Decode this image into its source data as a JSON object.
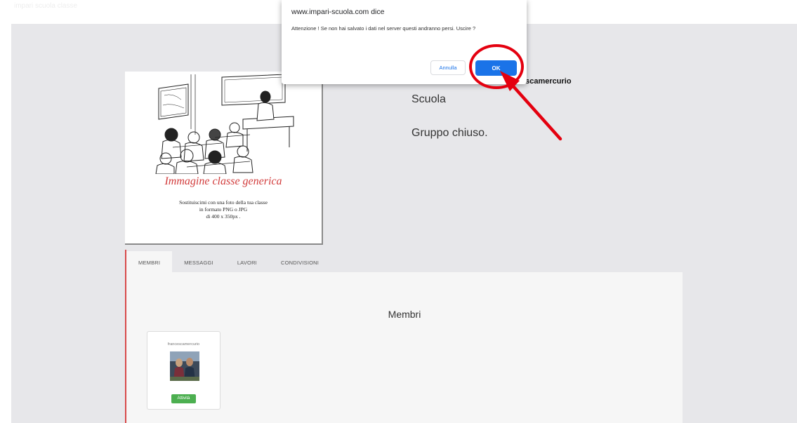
{
  "page": {
    "top_strip_text": "impari scuola classe"
  },
  "class_card": {
    "caption": "Immagine classe generica",
    "subcaption_lines": [
      "Sostituiscimi con una foto della tua classe",
      "in formato PNG o JPG",
      "di 400 x 350px ."
    ]
  },
  "group": {
    "owner_name": "escamercurio",
    "school": "Scuola",
    "status": "Gruppo chiuso."
  },
  "tabs": [
    {
      "label": "MEMBRI",
      "active": true
    },
    {
      "label": "MESSAGGI",
      "active": false
    },
    {
      "label": "LAVORI",
      "active": false
    },
    {
      "label": "CONDIVISIONI",
      "active": false
    }
  ],
  "members_panel": {
    "title": "Membri",
    "members": [
      {
        "name": "francescamercurio",
        "action_label": "Attività"
      }
    ]
  },
  "dialog": {
    "origin": "www.impari-scuola.com dice",
    "message": "Attenzione ! Se non hai salvato i dati nel server questi andranno persi. Uscire ?",
    "cancel_label": "Annulla",
    "ok_label": "OK"
  },
  "colors": {
    "background": "#e7e7ea",
    "accent_red": "#d84a4a",
    "primary_blue": "#1a73e8",
    "activity_green": "#4caf50",
    "annotation_red": "#e4000f"
  },
  "icons": {
    "annotation": "red-circle-and-arrow-pointing-to-ok"
  }
}
